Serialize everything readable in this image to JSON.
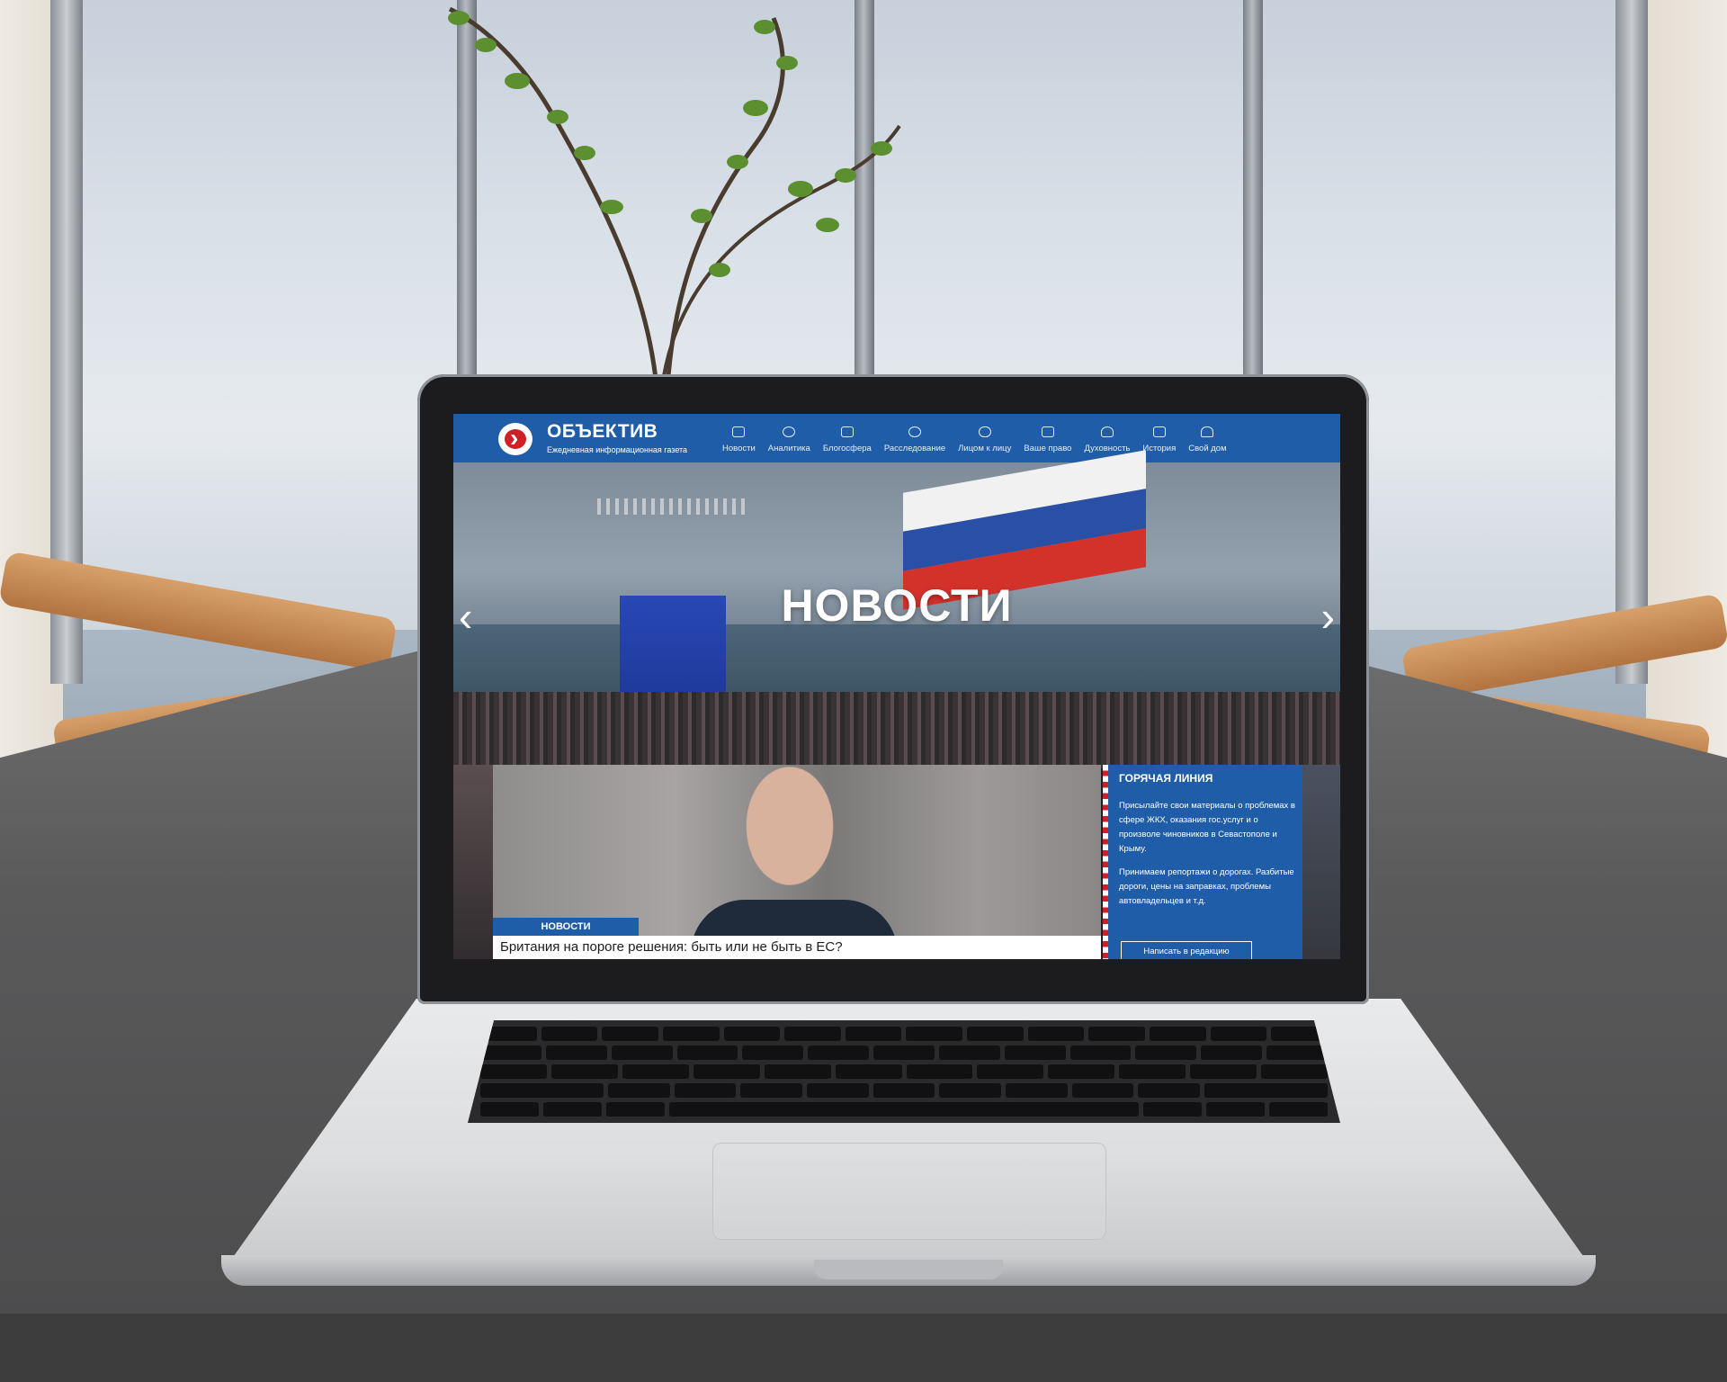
{
  "site": {
    "title": "ОБЪЕКТИВ",
    "tagline": "Ежедневная информационная газета"
  },
  "nav": {
    "items": [
      {
        "label": "Новости",
        "icon": "news-icon"
      },
      {
        "label": "Аналитика",
        "icon": "analytics-icon"
      },
      {
        "label": "Блогосфера",
        "icon": "blog-icon"
      },
      {
        "label": "Расследование",
        "icon": "search-icon"
      },
      {
        "label": "Лицом к лицу",
        "icon": "people-icon"
      },
      {
        "label": "Ваше право",
        "icon": "briefcase-icon"
      },
      {
        "label": "Духовность",
        "icon": "spirituality-icon"
      },
      {
        "label": "История",
        "icon": "history-icon"
      },
      {
        "label": "Свой дом",
        "icon": "home-icon"
      }
    ]
  },
  "hero": {
    "title": "НОВОСТИ",
    "prev_glyph": "‹",
    "next_glyph": "›"
  },
  "featured": {
    "badge": "НОВОСТИ",
    "headline": "Британия на пороге решения: быть или не быть в ЕС?"
  },
  "hotline": {
    "title": "ГОРЯЧАЯ ЛИНИЯ",
    "paragraph1": "Присылайте свои материалы о проблемах в сфере ЖКХ, оказания гос.услуг и о произволе чиновников в Севастополе и Крыму.",
    "paragraph2": "Принимаем репортажи о дорогах. Разбитые дороги, цены на заправках, проблемы автовладельцев и т.д.",
    "button": "Написать в редакцию"
  },
  "colors": {
    "brand_blue": "#1f5da8",
    "accent_red": "#cf2027"
  }
}
